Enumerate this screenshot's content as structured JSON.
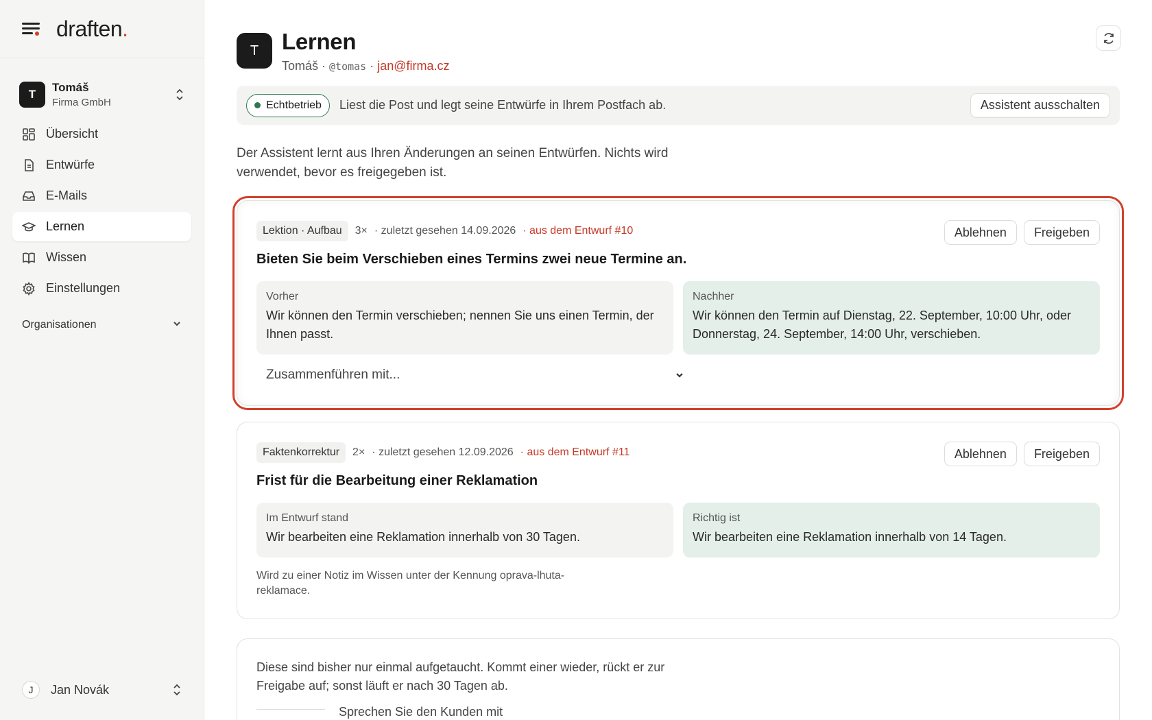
{
  "brand": {
    "name": "draften",
    "dot": "."
  },
  "workspace": {
    "initial": "T",
    "name": "Tomáš",
    "org": "Firma GmbH"
  },
  "nav": [
    {
      "label": "Übersicht",
      "icon": "grid-icon"
    },
    {
      "label": "Entwürfe",
      "icon": "document-icon"
    },
    {
      "label": "E-Mails",
      "icon": "inbox-icon"
    },
    {
      "label": "Lernen",
      "icon": "graduation-cap-icon",
      "active": true
    },
    {
      "label": "Wissen",
      "icon": "book-icon"
    },
    {
      "label": "Einstellungen",
      "icon": "gear-icon"
    }
  ],
  "organizations_label": "Organisationen",
  "user": {
    "initial": "J",
    "name": "Jan Novák"
  },
  "header": {
    "initial": "T",
    "title": "Lernen",
    "name": "Tomáš",
    "sep": " · ",
    "handle": "@tomas",
    "email": "jan@firma.cz"
  },
  "status": {
    "badge": "Echtbetrieb",
    "text": "Liest die Post und legt seine Entwürfe in Ihrem Postfach ab.",
    "button": "Assistent ausschalten",
    "color": "#2d7a4f"
  },
  "intro": "Der Assistent lernt aus Ihren Änderungen an seinen Entwürfen. Nichts wird verwendet, bevor es freigegeben ist.",
  "cards": [
    {
      "tag": "Lektion · Aufbau",
      "count": "3×",
      "seen": "· zuletzt gesehen 14.09.2026",
      "source": "· aus dem Entwurf #10",
      "reject": "Ablehnen",
      "approve": "Freigeben",
      "title": "Bieten Sie beim Verschieben eines Termins zwei neue Termine an.",
      "before_label": "Vorher",
      "before_text": "Wir können den Termin verschieben; nennen Sie uns einen Termin, der Ihnen passt.",
      "after_label": "Nachher",
      "after_text": "Wir können den Termin auf Dienstag, 22. September, 10:00 Uhr, oder Donnerstag, 24. September, 14:00 Uhr, verschieben.",
      "merge_placeholder": "Zusammenführen mit..."
    },
    {
      "tag": "Faktenkorrektur",
      "count": "2×",
      "seen": "· zuletzt gesehen 12.09.2026",
      "source": "· aus dem Entwurf #11",
      "reject": "Ablehnen",
      "approve": "Freigeben",
      "title": "Frist für die Bearbeitung einer Reklamation",
      "before_label": "Im Entwurf stand",
      "before_text": "Wir bearbeiten eine Reklamation innerhalb von 30 Tagen.",
      "after_label": "Richtig ist",
      "after_text": "Wir bearbeiten eine Reklamation innerhalb von 14 Tagen.",
      "note": "Wird zu einer Notiz im Wissen unter der Kennung oprava-lhuta-reklamace."
    }
  ],
  "pending": {
    "text": "Diese sind bisher nur einmal aufgetaucht. Kommt einer wieder, rückt er zur Freigabe auf; sonst läuft er nach 30 Tagen ab.",
    "first_item": "Sprechen Sie den Kunden mit"
  },
  "colors": {
    "accent": "#d2402c",
    "after_panel": "#e3efe8",
    "success": "#2d7a4f"
  }
}
